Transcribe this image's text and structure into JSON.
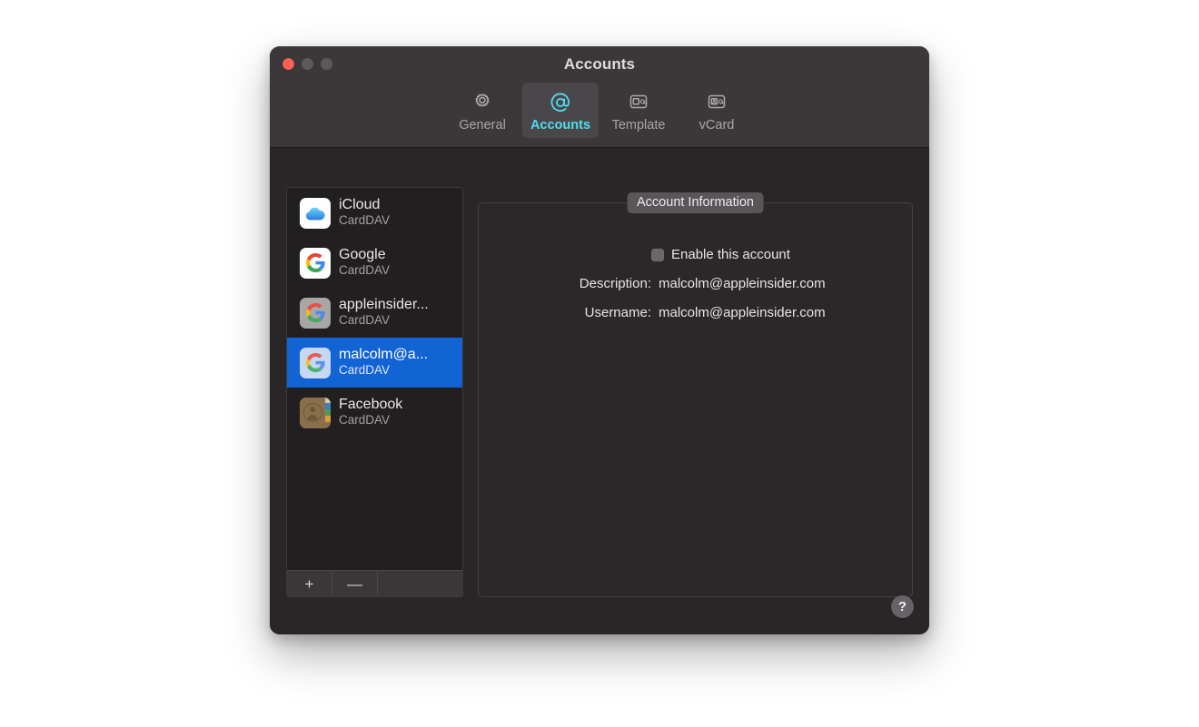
{
  "window": {
    "title": "Accounts",
    "traffic_lights": [
      {
        "name": "close",
        "color": "#ff5f57"
      },
      {
        "name": "minimize",
        "color": "#5d595c"
      },
      {
        "name": "maximize",
        "color": "#5d595c"
      }
    ]
  },
  "toolbar": {
    "accent_color": "#4edcf0",
    "items": [
      {
        "label": "General",
        "icon": "gear-icon",
        "active": false
      },
      {
        "label": "Accounts",
        "icon": "at-sign-icon",
        "active": true
      },
      {
        "label": "Template",
        "icon": "template-card-icon",
        "active": false
      },
      {
        "label": "vCard",
        "icon": "vcard-contact-icon",
        "active": false
      }
    ]
  },
  "sidebar": {
    "accounts": [
      {
        "name": "iCloud",
        "type": "CardDAV",
        "icon": "icloud-icon",
        "selected": false
      },
      {
        "name": "Google",
        "type": "CardDAV",
        "icon": "google-icon",
        "selected": false
      },
      {
        "name": "appleinsider...",
        "type": "CardDAV",
        "icon": "google-dim-icon",
        "selected": false
      },
      {
        "name": "malcolm@a...",
        "type": "CardDAV",
        "icon": "google-icon",
        "selected": true
      },
      {
        "name": "Facebook",
        "type": "CardDAV",
        "icon": "contacts-book-icon",
        "selected": false
      }
    ],
    "add_label": "+",
    "remove_label": "—",
    "selection_color": "#1263d4"
  },
  "panel": {
    "legend": "Account Information",
    "enable_checkbox": {
      "label": "Enable this account",
      "checked": false
    },
    "fields": [
      {
        "label": "Description:",
        "value": "malcolm@appleinsider.com"
      },
      {
        "label": "Username:",
        "value": "malcolm@appleinsider.com"
      }
    ]
  },
  "help": {
    "label": "?"
  }
}
